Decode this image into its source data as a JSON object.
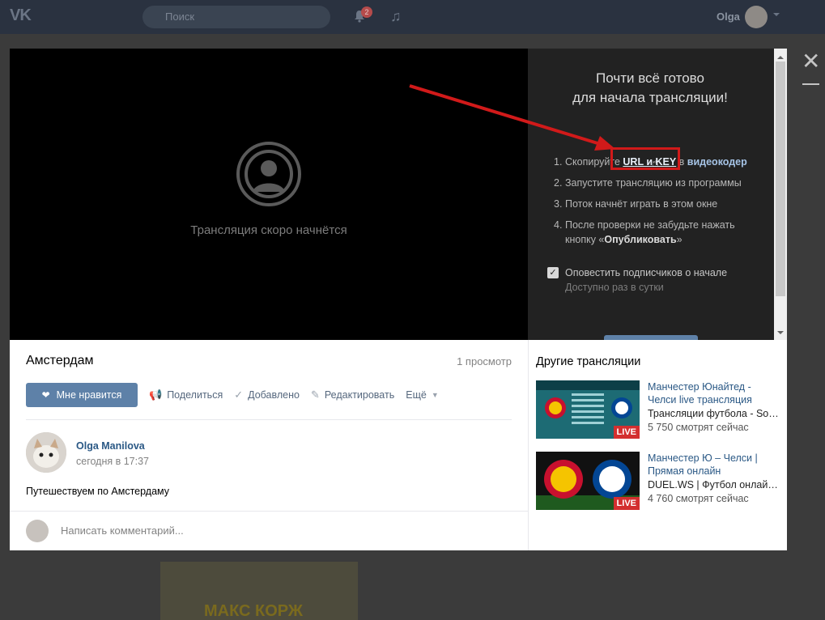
{
  "topbar": {
    "logo": "VK",
    "search_placeholder": "Поиск",
    "notif_count": "2",
    "username": "Olga"
  },
  "background": {
    "thumb_text": "МАКС КОРЖ"
  },
  "player": {
    "status_text": "Трансляция скоро начнётся"
  },
  "panel": {
    "title_line1": "Почти всё готово",
    "title_line2": "для начала трансляции!",
    "steps": [
      {
        "num": "1.",
        "pre": "Скопируйте ",
        "link": "URL и KEY",
        "mid": " в ",
        "link2": "видеокодер"
      },
      {
        "num": "2.",
        "text": "Запустите трансляцию из программы"
      },
      {
        "num": "3.",
        "text": "Поток начнёт играть в этом окне"
      },
      {
        "num": "4.",
        "text": "После проверки не забудьте нажать",
        "line2_pre": "кнопку «",
        "line2_bold": "Опубликовать",
        "line2_post": "»"
      }
    ],
    "notify_checked": true,
    "notify_label": "Оповестить подписчиков о начале",
    "notify_sub": "Доступно раз в сутки"
  },
  "video": {
    "title": "Амстердам",
    "views": "1 просмотр",
    "actions": {
      "like": "Мне нравится",
      "share": "Поделиться",
      "added": "Добавлено",
      "edit": "Редактировать",
      "more": "Ещё"
    },
    "author": {
      "name": "Olga Manilova",
      "time": "сегодня в 17:37"
    },
    "description": "Путешествуем по Амстердаму",
    "comment_placeholder": "Написать комментарий..."
  },
  "other": {
    "heading": "Другие трансляции",
    "items": [
      {
        "title": "Манчестер Юнайтед - Челси live трансляция",
        "author": "Трансляции футбола - Sop...",
        "views": "5 750 смотрят сейчас",
        "badge": "LIVE"
      },
      {
        "title": "Манчестер Ю – Челси | Прямая онлайн",
        "author": "DUEL.WS | Футбол онлайн ...",
        "views": "4 760 смотрят сейчас",
        "badge": "LIVE"
      }
    ]
  },
  "colors": {
    "accent": "#5e81a8",
    "link": "#2a5885",
    "highlight": "#d11a1a",
    "live": "#d32f2f"
  }
}
